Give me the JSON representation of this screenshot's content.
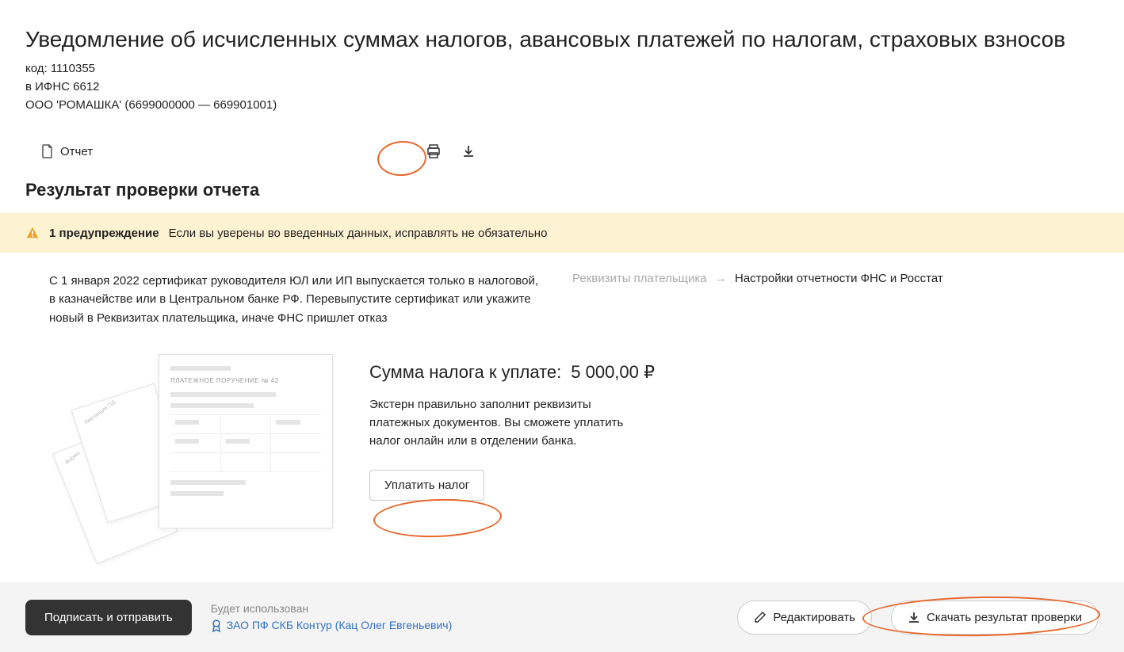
{
  "header": {
    "title": "Уведомление об исчисленных суммах налогов, авансовых платежей по налогам, страховых взносов",
    "code_line": "код: 1110355",
    "dest_line": "в ИФНС 6612",
    "org_line": "ООО 'РОМАШКА' (6699000000 — 669901001)"
  },
  "toolbar": {
    "report_label": "Отчет"
  },
  "section": {
    "title": "Результат проверки отчета"
  },
  "warning": {
    "bold": "1 предупреждение",
    "text": "Если вы уверены во введенных данных, исправлять не обязательно"
  },
  "info": {
    "text": "С 1 января 2022 сертификат руководителя ЮЛ или ИП выпускается только в налоговой, в казначействе или в Центральном банке РФ. Перевыпустите сертификат или укажите новый в Реквизитах плательщика, иначе ФНС пришлет отказ",
    "link_grey": "Реквизиты плательщика",
    "link_dark": "Настройки отчетности ФНС и Росстат"
  },
  "payment": {
    "label": "Сумма налога к уплате:",
    "amount": "5 000,00 ₽",
    "descr": "Экстерн правильно заполнит реквизиты платежных документов. Вы сможете уплатить налог онлайн или в отделении банка.",
    "button": "Уплатить налог",
    "doc_title": "ПЛАТЕЖНОЕ ПОРУЧЕНИЕ № 42"
  },
  "footer": {
    "submit": "Подписать и отправить",
    "cert_label": "Будет использован",
    "cert_link": "ЗАО ПФ СКБ Контур (Кац Олег Евгеньевич)",
    "edit": "Редактировать",
    "download": "Скачать результат проверки"
  }
}
